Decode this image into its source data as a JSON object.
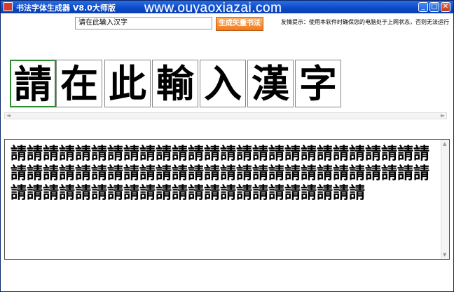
{
  "window": {
    "title": "书法字体生成器 V8.0大师版",
    "watermark": "www.ouyaoxiazai.com",
    "minimize_glyph": "_",
    "maximize_glyph": "□",
    "close_glyph": "✕"
  },
  "toolbar": {
    "input_value": "请在此输入汉字",
    "generate_label": "生成矢量书法",
    "tip": "友情提示：使用本软件时确保您的电脑处于上网状态，否则无法运行"
  },
  "preview": {
    "chars": [
      "請",
      "在",
      "此",
      "輸",
      "入",
      "漢",
      "字"
    ],
    "selected_index": 0
  },
  "output": {
    "text": "請請請請請請請請請請請請請請請請請請請請請請請請請請請請請請請請請請請請請請請請請請請請請請請請請請請請請請請請請請請請請請請請請請請請請請請請請請"
  },
  "colors": {
    "title_bar": "#0b49c9",
    "generate_button": "#f07a20",
    "selected_border": "#2e8b2e"
  }
}
